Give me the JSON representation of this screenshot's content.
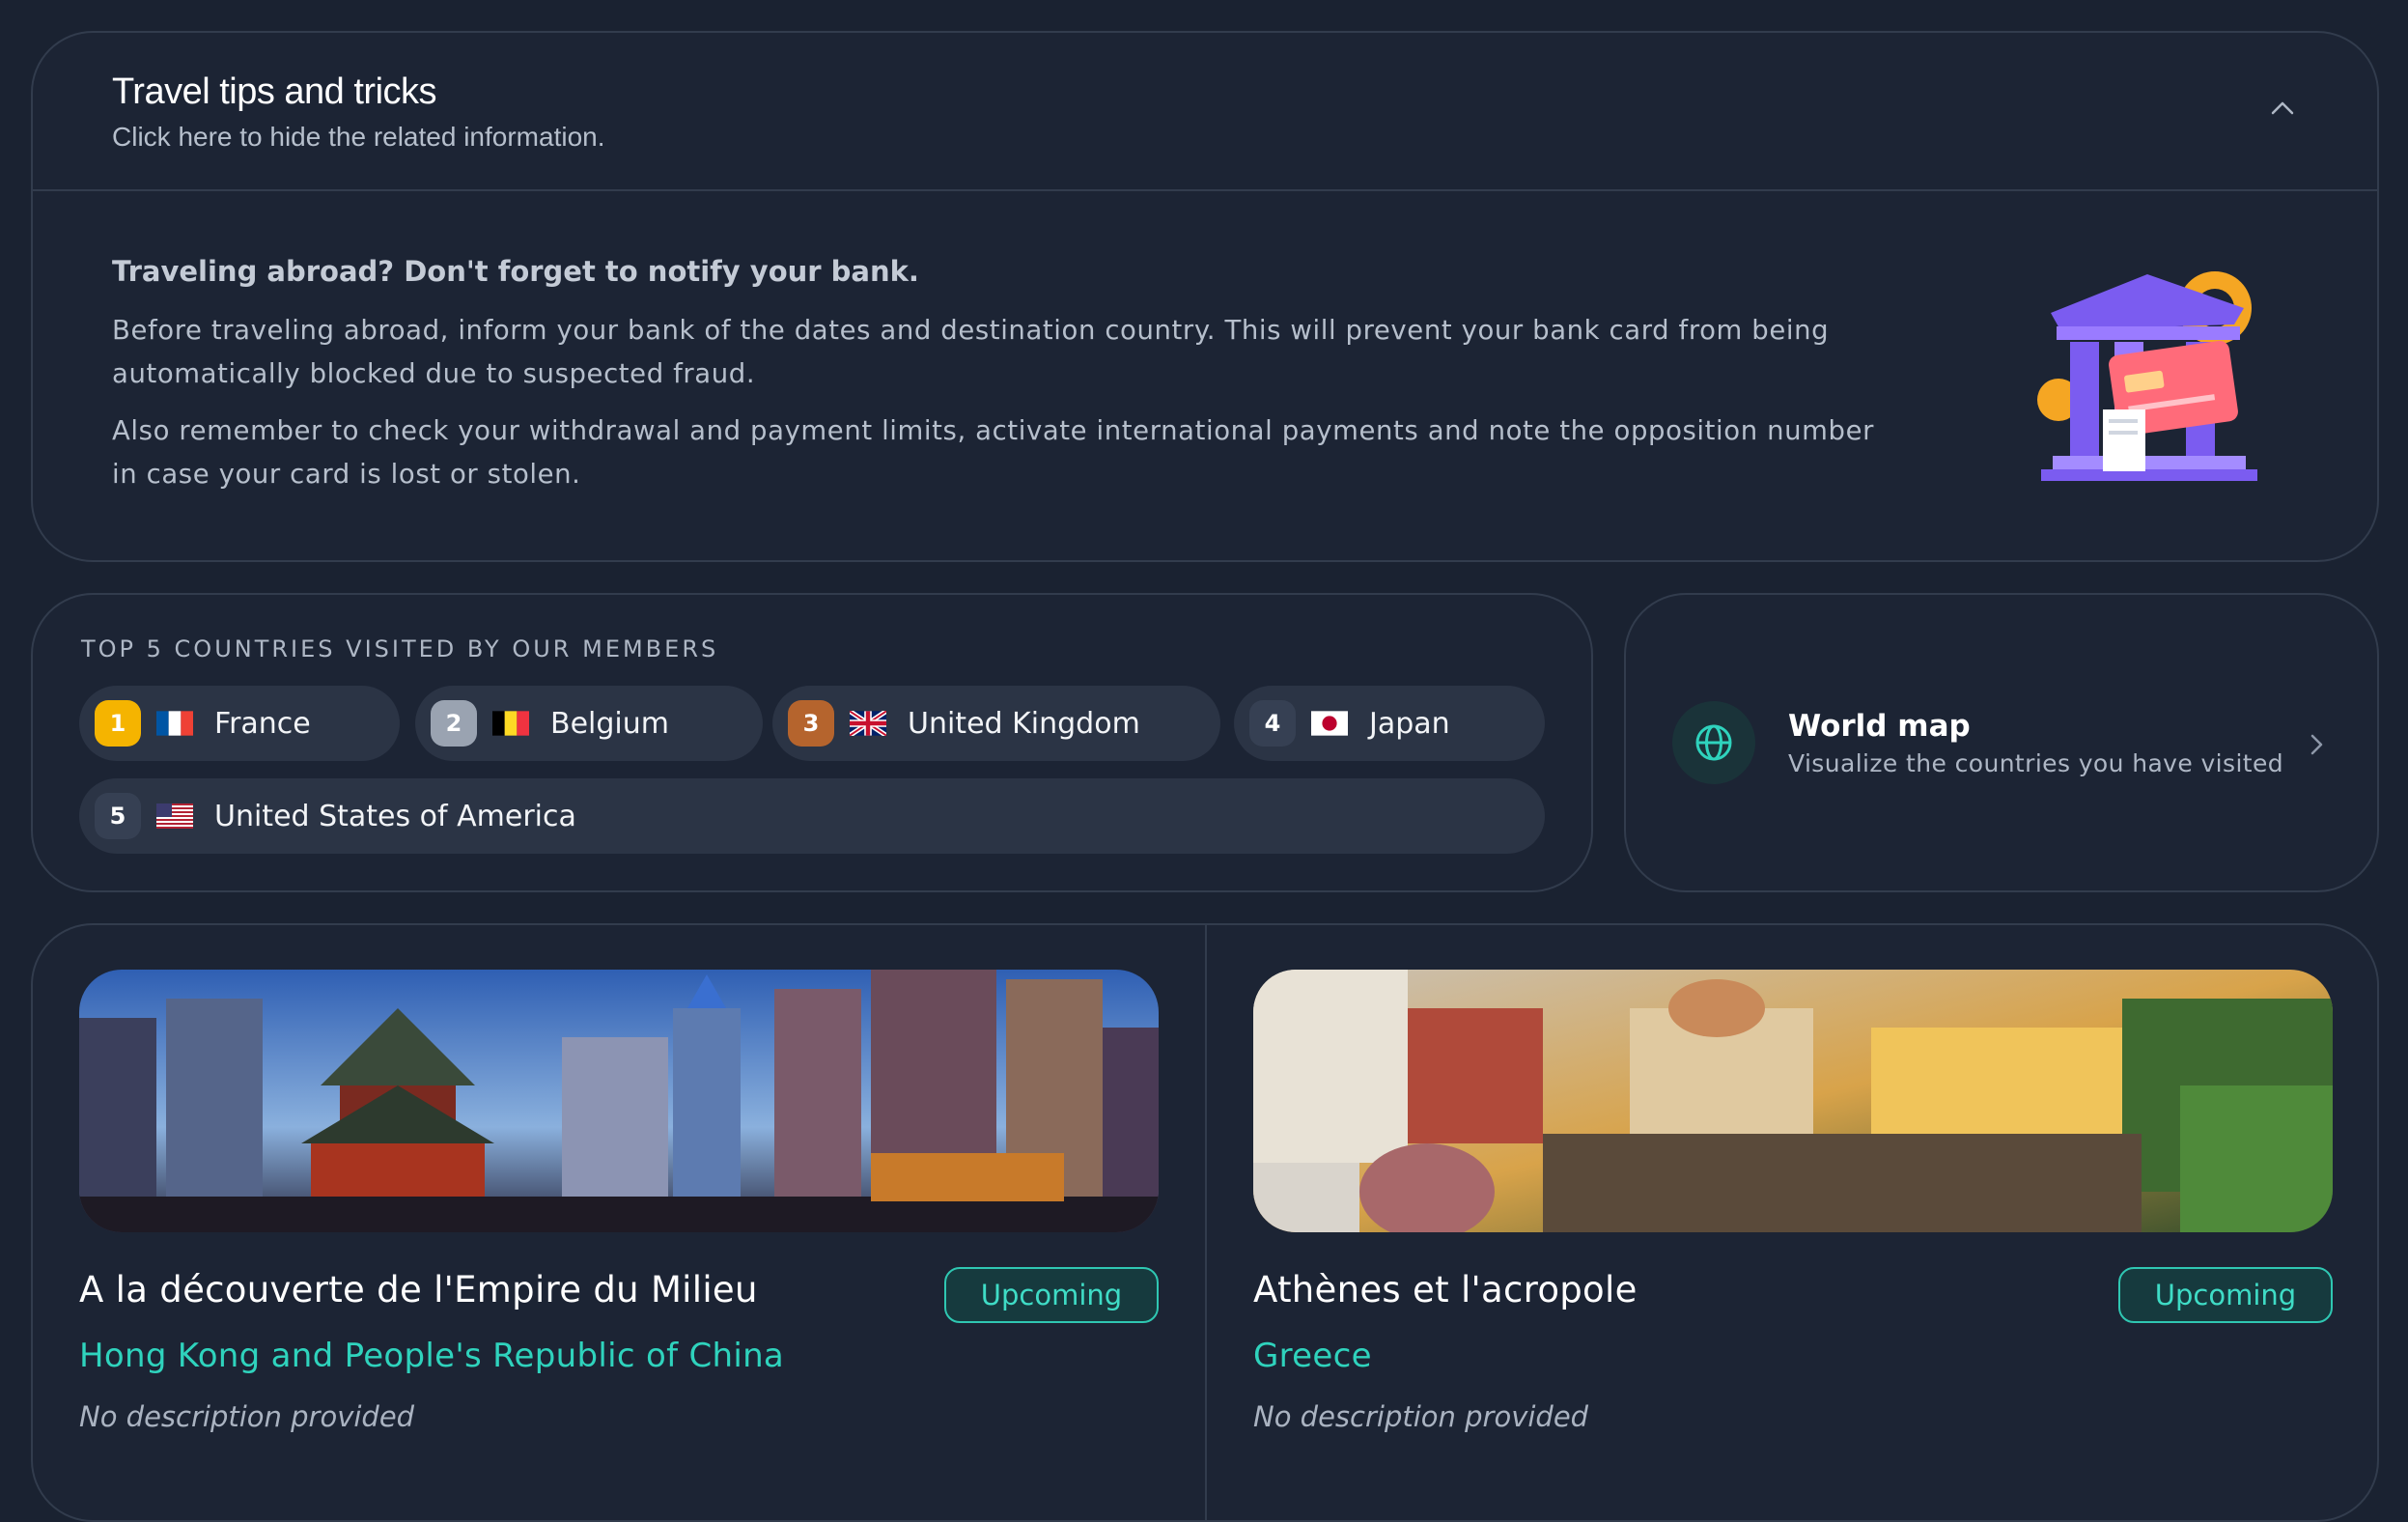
{
  "tips": {
    "title": "Travel tips and tricks",
    "subtitle": "Click here to hide the related information.",
    "heading": "Traveling abroad? Don't forget to notify your bank.",
    "paragraph1": "Before traveling abroad, inform your bank of the dates and destination country. This will prevent your bank card from being automatically blocked due to suspected fraud.",
    "paragraph2": "Also remember to check your withdrawal and payment limits, activate international payments and note the opposition number in case your card is lost or stolen."
  },
  "top_countries": {
    "title": "Top 5 countries visited by our members",
    "items": [
      {
        "rank": "1",
        "name": "France",
        "rank_color": "#f5b400",
        "flag": "france-flag"
      },
      {
        "rank": "2",
        "name": "Belgium",
        "rank_color": "#9aa3b1",
        "flag": "belgium-flag"
      },
      {
        "rank": "3",
        "name": "United Kingdom",
        "rank_color": "#b5642d",
        "flag": "uk-flag"
      },
      {
        "rank": "4",
        "name": "Japan",
        "rank_color": "#364053",
        "flag": "japan-flag"
      },
      {
        "rank": "5",
        "name": "United States of America",
        "rank_color": "#364053",
        "flag": "usa-flag"
      }
    ]
  },
  "world_map": {
    "title": "World map",
    "subtitle": "Visualize the countries you have visited",
    "icon": "globe-icon"
  },
  "trips": [
    {
      "title": "A la découverte de l'Empire du Milieu",
      "status": "Upcoming",
      "country": "Hong Kong and People's Republic of China",
      "description": "No description provided"
    },
    {
      "title": "Athènes et l'acropole",
      "status": "Upcoming",
      "country": "Greece",
      "description": "No description provided"
    }
  ],
  "colors": {
    "background": "#1a2231",
    "accent": "#2fd3bd",
    "card_border": "#323c4d"
  }
}
